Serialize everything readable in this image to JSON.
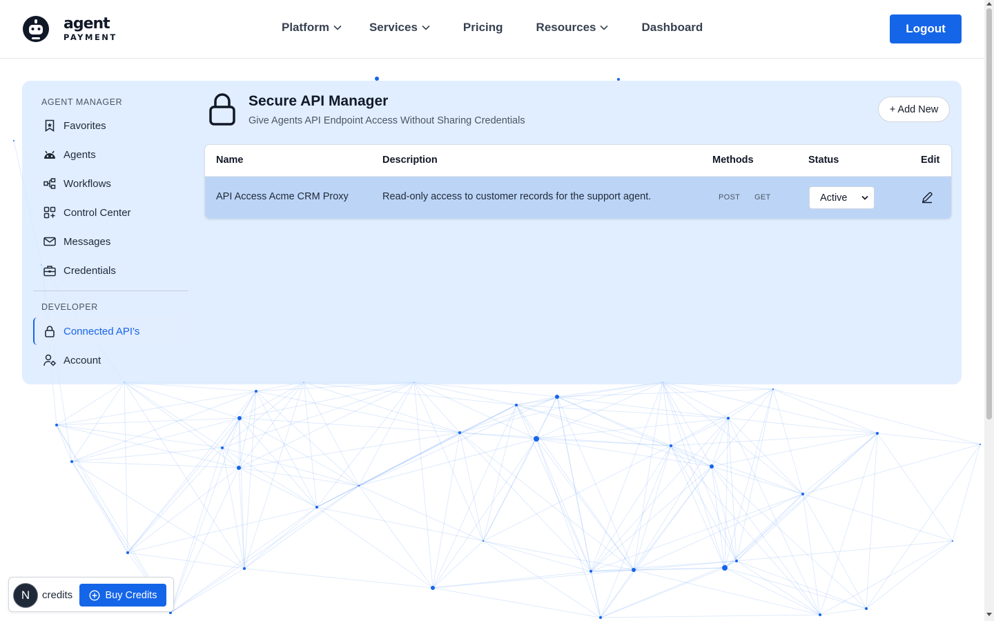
{
  "header": {
    "logo_word": "agent",
    "logo_sub": "PAYMENT",
    "nav": [
      {
        "label": "Platform",
        "dropdown": true
      },
      {
        "label": "Services",
        "dropdown": true
      },
      {
        "label": "Pricing",
        "dropdown": false
      },
      {
        "label": "Resources",
        "dropdown": true
      },
      {
        "label": "Dashboard",
        "dropdown": false
      }
    ],
    "logout_label": "Logout"
  },
  "sidebar": {
    "agent_manager_title": "AGENT MANAGER",
    "agent_manager_items": [
      {
        "label": "Favorites",
        "icon": "bookmark-icon"
      },
      {
        "label": "Agents",
        "icon": "robot-icon"
      },
      {
        "label": "Workflows",
        "icon": "workflow-icon"
      },
      {
        "label": "Control Center",
        "icon": "grid-plus-icon"
      },
      {
        "label": "Messages",
        "icon": "envelope-icon"
      },
      {
        "label": "Credentials",
        "icon": "briefcase-icon"
      }
    ],
    "developer_title": "DEVELOPER",
    "developer_items": [
      {
        "label": "Connected API's",
        "icon": "lock-icon",
        "active": true
      },
      {
        "label": "Account",
        "icon": "user-gear-icon",
        "active": false
      }
    ]
  },
  "main": {
    "title": "Secure API Manager",
    "subtitle": "Give Agents API Endpoint Access Without Sharing Credentials",
    "add_new_label": "+ Add New",
    "table": {
      "headers": [
        "Name",
        "Description",
        "Methods",
        "Status",
        "Edit"
      ],
      "rows": [
        {
          "name": "API Access Acme CRM Proxy",
          "description": "Read-only access to customer records for the support agent.",
          "methods": [
            "POST",
            "GET"
          ],
          "status": "Active"
        }
      ]
    }
  },
  "credits_widget": {
    "avatar_letter": "N",
    "credits_label": "credits",
    "buy_label": "Buy Credits"
  },
  "colors": {
    "accent": "#1565e8",
    "panel": "#d6e7ff",
    "row_highlight": "#bcd5f7"
  }
}
